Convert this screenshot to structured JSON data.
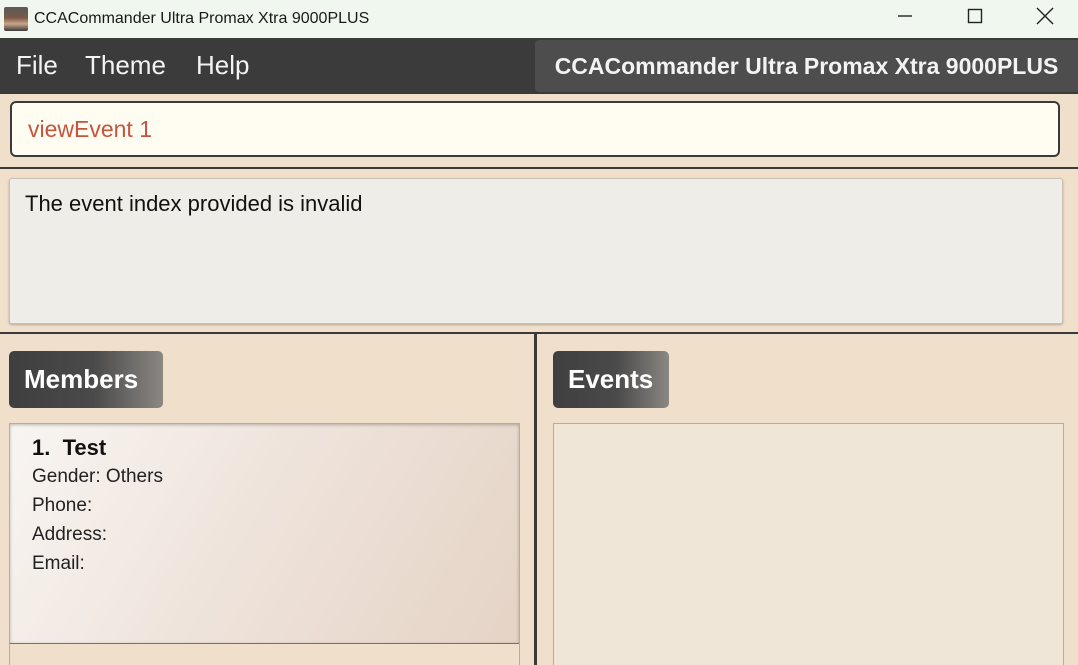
{
  "window": {
    "title": "CCACommander Ultra Promax Xtra 9000PLUS"
  },
  "menu": {
    "items": [
      "File",
      "Theme",
      "Help"
    ],
    "app_name": "CCACommander Ultra Promax Xtra 9000PLUS"
  },
  "command": {
    "value": "viewEvent 1"
  },
  "result": {
    "message": "The event index provided is invalid"
  },
  "members": {
    "header": "Members",
    "items": [
      {
        "index": "1.",
        "name": "Test",
        "gender": "Gender: Others",
        "phone": "Phone:",
        "address": "Address:",
        "email": "Email:"
      }
    ]
  },
  "events": {
    "header": "Events",
    "items": []
  },
  "colors": {
    "menubar": "#3b3b3b",
    "background": "#efdfcb",
    "command_text": "#c2563f"
  }
}
